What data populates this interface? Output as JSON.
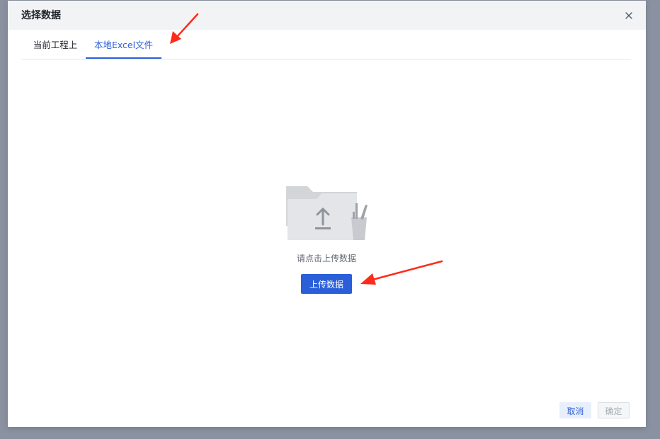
{
  "dialog": {
    "title": "选择数据",
    "close_icon": "close-icon"
  },
  "tabs": [
    {
      "label": "当前工程上",
      "active": false
    },
    {
      "label": "本地Excel文件",
      "active": true
    }
  ],
  "empty_state": {
    "illustration_icon": "folder-upload-icon",
    "hint": "请点击上传数据",
    "upload_label": "上传数据"
  },
  "footer": {
    "cancel_label": "取消",
    "confirm_label": "确定"
  },
  "colors": {
    "accent": "#2b5fd9",
    "annotation": "#ff2a1a",
    "overlay": "#8a92a1"
  }
}
